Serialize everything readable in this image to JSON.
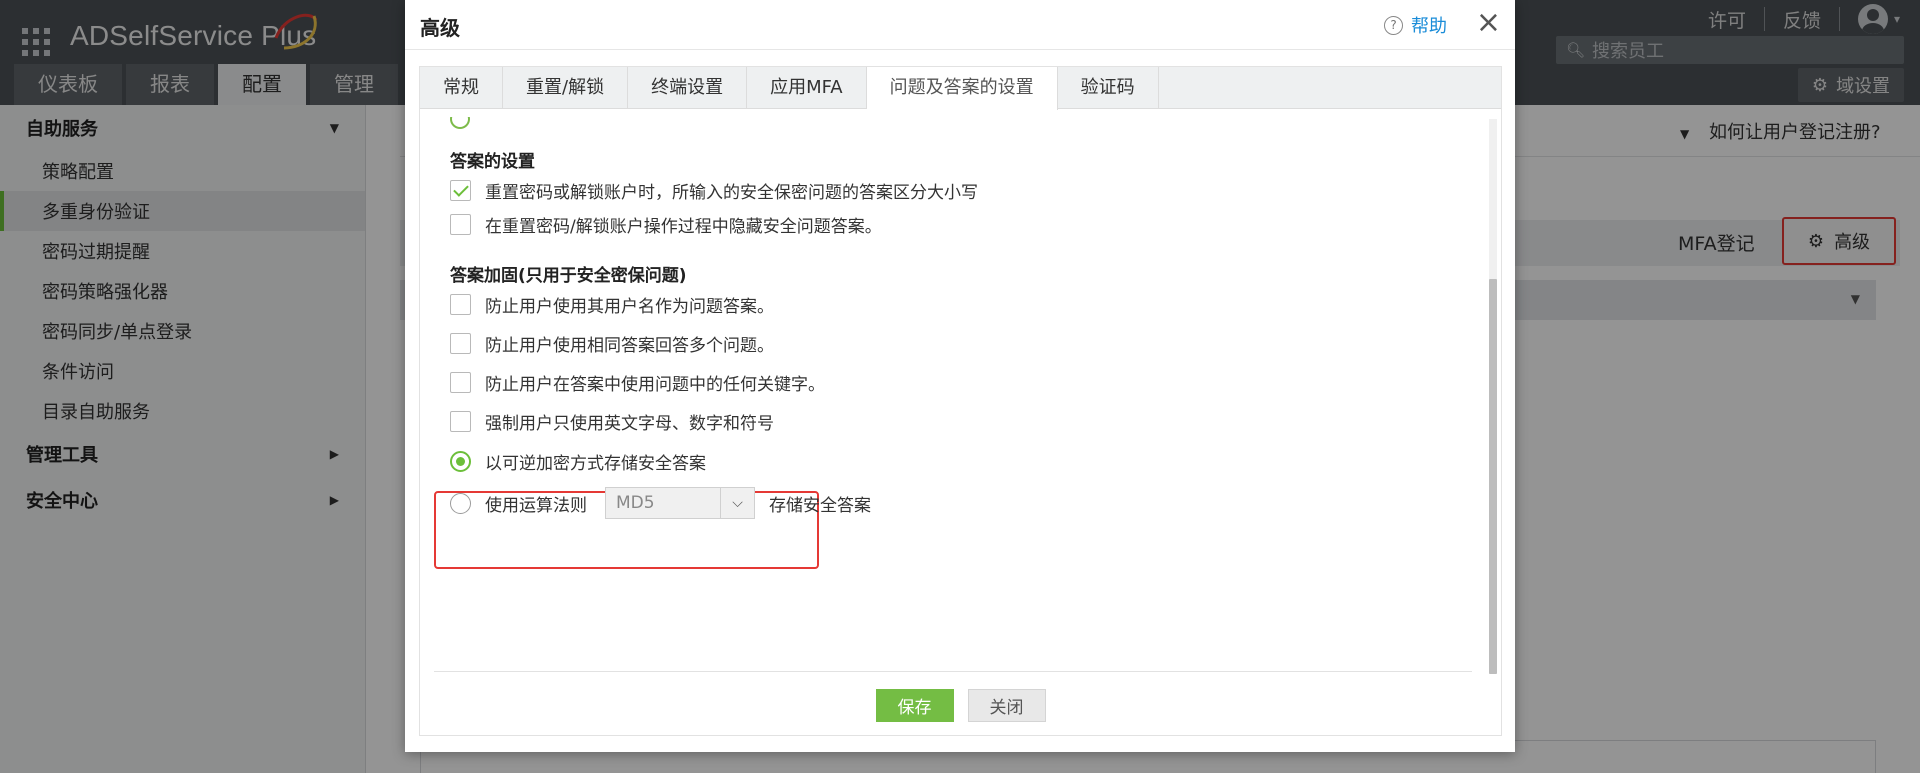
{
  "app": {
    "logo_text": "ADSelfService Plus",
    "main_tabs": [
      "仪表板",
      "报表",
      "配置",
      "管理"
    ],
    "active_main_tab": "配置",
    "top_links": {
      "license": "许可",
      "feedback": "反馈"
    },
    "employee_search_placeholder": "搜索员工",
    "domain_settings": "域设置"
  },
  "sidebar": {
    "sections": [
      {
        "label": "自助服务",
        "expanded": true,
        "items": [
          "策略配置",
          "多重身份验证",
          "密码过期提醒",
          "密码策略强化器",
          "密码同步/单点登录",
          "条件访问",
          "目录自助服务"
        ],
        "active_item": "多重身份验证"
      },
      {
        "label": "管理工具",
        "expanded": false
      },
      {
        "label": "安全中心",
        "expanded": false
      }
    ]
  },
  "content": {
    "help_hint": "如何让用户登记注册?",
    "mfa_enroll": "MFA登记",
    "advanced_button": "高级"
  },
  "modal": {
    "title": "高级",
    "help_label": "帮助",
    "close_symbol": "×",
    "tabs": [
      "常规",
      "重置/解锁",
      "终端设置",
      "应用MFA",
      "问题及答案的设置",
      "验证码"
    ],
    "active_tab": "问题及答案的设置",
    "answer_settings": {
      "title": "答案的设置",
      "options": [
        {
          "label": "重置密码或解锁账户时，所输入的安全保密问题的答案区分大小写",
          "checked": true
        },
        {
          "label": "在重置密码/解锁账户操作过程中隐藏安全问题答案。",
          "checked": false
        }
      ]
    },
    "answer_hardening": {
      "title": "答案加固(只用于安全密保问题)",
      "options": [
        {
          "label": "防止用户使用其用户名作为问题答案。",
          "checked": false
        },
        {
          "label": "防止用户使用相同答案回答多个问题。",
          "checked": false
        },
        {
          "label": "防止用户在答案中使用问题中的任何关键字。",
          "checked": false
        },
        {
          "label": "强制用户只使用英文字母、数字和符号",
          "checked": false
        }
      ]
    },
    "storage": {
      "reversible_label": "以可逆加密方式存储安全答案",
      "reversible_selected": true,
      "algorithm_prefix": "使用运算法则",
      "algorithm_value": "MD5",
      "algorithm_suffix": "存储安全答案",
      "algorithm_selected": false
    },
    "buttons": {
      "save": "保存",
      "close": "关闭"
    }
  },
  "colors": {
    "accent_green": "#74bd44",
    "highlight_red": "#e53935",
    "link_blue": "#1a8cd8",
    "topbar": "#4c5257"
  }
}
